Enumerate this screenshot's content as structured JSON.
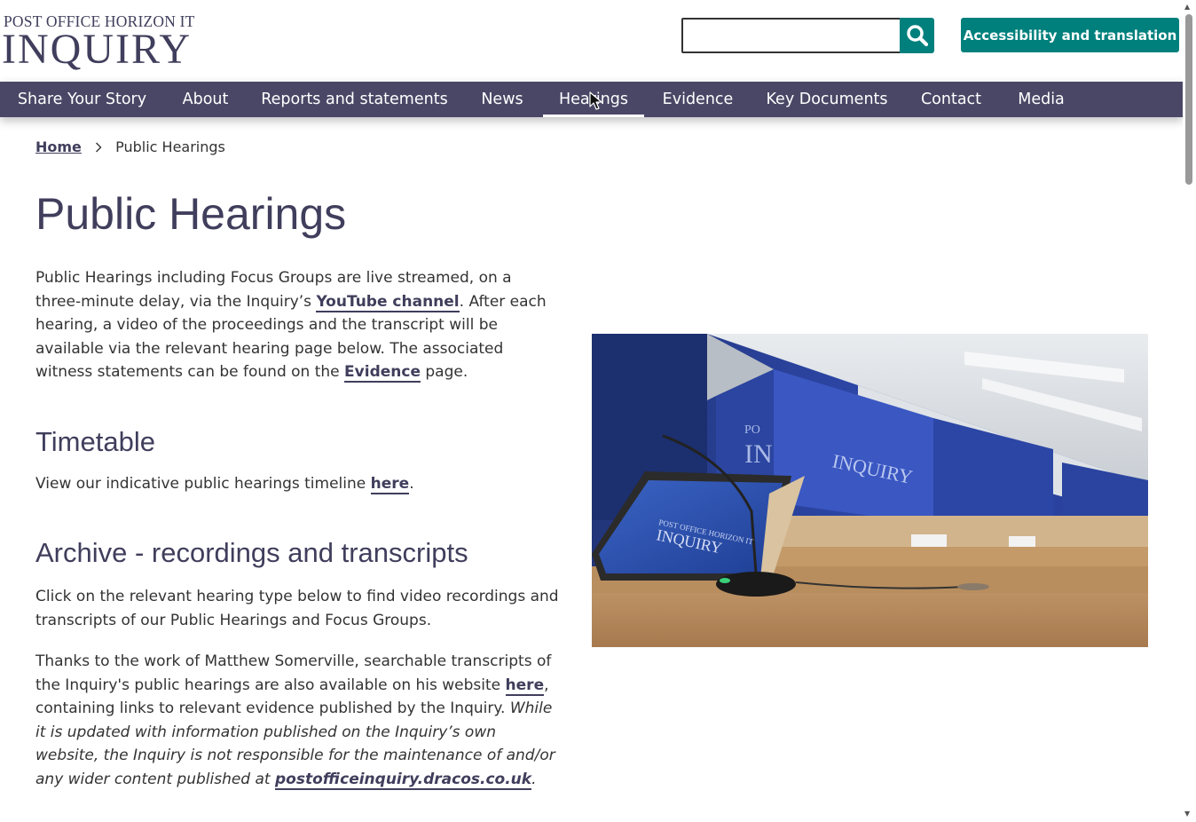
{
  "header": {
    "logo_top": "POST OFFICE HORIZON IT",
    "logo_main": "INQUIRY",
    "search": {
      "value": "",
      "placeholder": ""
    },
    "accessibility_button": "Accessibility and translation"
  },
  "nav": {
    "items": [
      {
        "label": "Share Your Story"
      },
      {
        "label": "About"
      },
      {
        "label": "Reports and statements"
      },
      {
        "label": "News"
      },
      {
        "label": "Hearings",
        "active": true
      },
      {
        "label": "Evidence"
      },
      {
        "label": "Key Documents"
      },
      {
        "label": "Contact"
      },
      {
        "label": "Media"
      }
    ]
  },
  "breadcrumb": {
    "home": "Home",
    "current": "Public Hearings"
  },
  "main": {
    "title": "Public Hearings",
    "intro": {
      "t1": "Public Hearings including Focus Groups are live streamed, on a three-minute delay, via the Inquiry’s ",
      "youtube_link": "YouTube channel",
      "t2": ". After each hearing, a video of the proceedings and the transcript will be available via the relevant hearing page below. The associated witness statements can be found on the ",
      "evidence_link": "Evidence",
      "t3": " page."
    },
    "timetable": {
      "heading": "Timetable",
      "t1": "View our indicative public hearings timeline ",
      "link": "here",
      "t2": "."
    },
    "archive": {
      "heading": "Archive - recordings and transcripts",
      "p1": "Click on the relevant hearing type below to find video recordings and transcripts of our Public Hearings and Focus Groups.",
      "p2_t1": "Thanks to the work of Matthew Somerville, searchable transcripts of the Inquiry's public hearings are also available on his website ",
      "p2_link": "here",
      "p2_t2": ", containing links to relevant evidence published by the Inquiry. ",
      "p2_italic": "While it is updated with information published on the Inquiry’s own website, the Inquiry is not responsible for the maintenance of and/or any wider content published at ",
      "p2_italic_link": "postofficeinquiry.dracos.co.uk",
      "p2_end": "."
    }
  },
  "photo": {
    "screen_logo_top": "POST OFFICE HORIZON IT",
    "screen_logo_main": "INQUIRY",
    "wall_logo_a": "PO",
    "wall_logo_b": "IN"
  },
  "colors": {
    "accent": "#00807d",
    "brand": "#403e5c",
    "nav_bg": "#4a4766"
  },
  "icons": {
    "search": "search-icon",
    "chevron": "chevron-right-icon",
    "cursor": "cursor-icon"
  }
}
